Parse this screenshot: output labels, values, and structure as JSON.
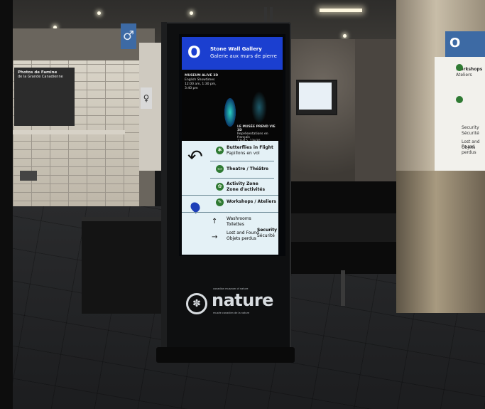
{
  "kiosk": {
    "header": {
      "icon_letter": "O",
      "title_en": "Stone Wall Gallery",
      "title_fr": "Galerie aux murs de pierre"
    },
    "exhibit": {
      "left_text": [
        "MUSEUM ALIVE 3D",
        "English Showtimes",
        "12:00 am, 1:30 pm, 3:40 pm"
      ],
      "right_text": [
        "LE MUSÉE PREND VIE 3D",
        "Représentations en français",
        "11H15, 13H30"
      ]
    },
    "directory": [
      {
        "en": "Butterflies in Flight",
        "fr": "Papillons en vol"
      },
      {
        "en": "Theatre / Théâtre",
        "fr": ""
      },
      {
        "en": "Activity Zone",
        "fr": "Zone d'activités"
      },
      {
        "en": "Workshops / Ateliers",
        "fr": ""
      }
    ],
    "services": {
      "washrooms_en": "Washrooms",
      "washrooms_fr": "Toilettes",
      "lost_en": "Lost and Found",
      "lost_fr": "Objets perdus",
      "security_en": "Security",
      "security_fr": "Sécurité"
    },
    "logo": {
      "word": "nature",
      "line1": "canadian museum of nature",
      "line2": "musée canadien de la nature"
    }
  },
  "column_sign": {
    "icon_letter": "O",
    "items": [
      "Workshops",
      "Ateliers",
      "Security",
      "Sécurité",
      "Lost and Found",
      "Objets perdus"
    ]
  },
  "wall_frame": {
    "title": "Photos de Famine",
    "subtitle": "de la Grande Canadienne"
  },
  "colors": {
    "kiosk_header_blue": "#1b3fd0",
    "directory_bg": "#e4f1f6",
    "icon_green": "#2f7a33"
  }
}
